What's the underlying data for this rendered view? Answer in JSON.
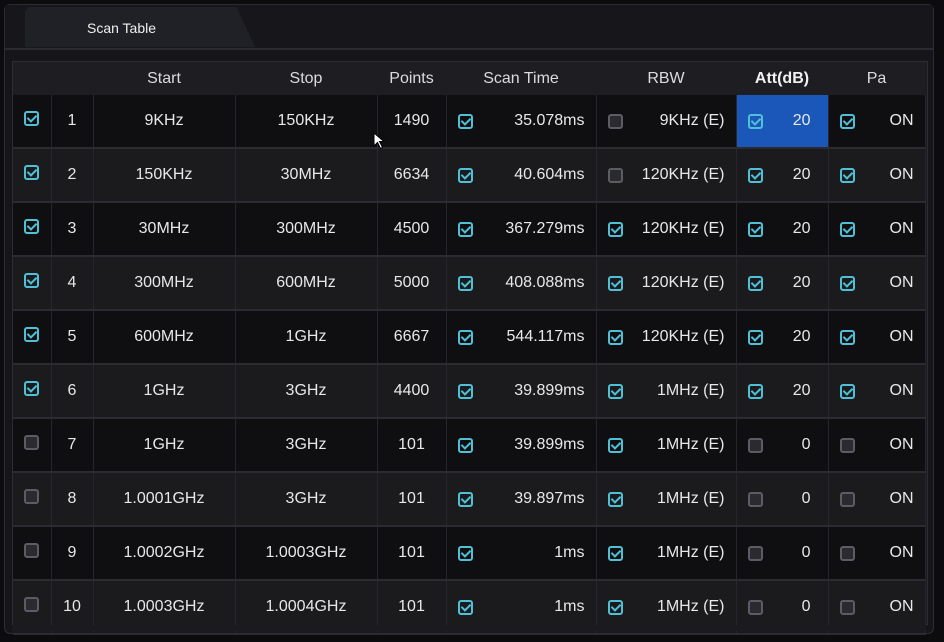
{
  "tab": {
    "label": "Scan Table"
  },
  "colors": {
    "accent": "#4fc0d6",
    "selected": "#1a57b8"
  },
  "columns": {
    "start": "Start",
    "stop": "Stop",
    "points": "Points",
    "scan_time": "Scan Time",
    "rbw": "RBW",
    "att": "Att(dB)",
    "pa": "Pa"
  },
  "rows": [
    {
      "enabled": true,
      "index": "1",
      "start": "9KHz",
      "stop": "150KHz",
      "points": "1490",
      "scan_auto": true,
      "scan_time": "35.078ms",
      "rbw_auto": false,
      "rbw": "9KHz (E)",
      "att_auto": true,
      "att": "20",
      "pa_auto": true,
      "pa": "ON"
    },
    {
      "enabled": true,
      "index": "2",
      "start": "150KHz",
      "stop": "30MHz",
      "points": "6634",
      "scan_auto": true,
      "scan_time": "40.604ms",
      "rbw_auto": false,
      "rbw": "120KHz (E)",
      "att_auto": true,
      "att": "20",
      "pa_auto": true,
      "pa": "ON"
    },
    {
      "enabled": true,
      "index": "3",
      "start": "30MHz",
      "stop": "300MHz",
      "points": "4500",
      "scan_auto": true,
      "scan_time": "367.279ms",
      "rbw_auto": true,
      "rbw": "120KHz (E)",
      "att_auto": true,
      "att": "20",
      "pa_auto": true,
      "pa": "ON"
    },
    {
      "enabled": true,
      "index": "4",
      "start": "300MHz",
      "stop": "600MHz",
      "points": "5000",
      "scan_auto": true,
      "scan_time": "408.088ms",
      "rbw_auto": true,
      "rbw": "120KHz (E)",
      "att_auto": true,
      "att": "20",
      "pa_auto": true,
      "pa": "ON"
    },
    {
      "enabled": true,
      "index": "5",
      "start": "600MHz",
      "stop": "1GHz",
      "points": "6667",
      "scan_auto": true,
      "scan_time": "544.117ms",
      "rbw_auto": true,
      "rbw": "120KHz (E)",
      "att_auto": true,
      "att": "20",
      "pa_auto": true,
      "pa": "ON"
    },
    {
      "enabled": true,
      "index": "6",
      "start": "1GHz",
      "stop": "3GHz",
      "points": "4400",
      "scan_auto": true,
      "scan_time": "39.899ms",
      "rbw_auto": true,
      "rbw": "1MHz (E)",
      "att_auto": true,
      "att": "20",
      "pa_auto": true,
      "pa": "ON"
    },
    {
      "enabled": false,
      "index": "7",
      "start": "1GHz",
      "stop": "3GHz",
      "points": "101",
      "scan_auto": true,
      "scan_time": "39.899ms",
      "rbw_auto": true,
      "rbw": "1MHz (E)",
      "att_auto": false,
      "att": "0",
      "pa_auto": false,
      "pa": "ON"
    },
    {
      "enabled": false,
      "index": "8",
      "start": "1.0001GHz",
      "stop": "3GHz",
      "points": "101",
      "scan_auto": true,
      "scan_time": "39.897ms",
      "rbw_auto": true,
      "rbw": "1MHz (E)",
      "att_auto": false,
      "att": "0",
      "pa_auto": false,
      "pa": "ON"
    },
    {
      "enabled": false,
      "index": "9",
      "start": "1.0002GHz",
      "stop": "1.0003GHz",
      "points": "101",
      "scan_auto": true,
      "scan_time": "1ms",
      "rbw_auto": true,
      "rbw": "1MHz (E)",
      "att_auto": false,
      "att": "0",
      "pa_auto": false,
      "pa": "ON"
    },
    {
      "enabled": false,
      "index": "10",
      "start": "1.0003GHz",
      "stop": "1.0004GHz",
      "points": "101",
      "scan_auto": true,
      "scan_time": "1ms",
      "rbw_auto": true,
      "rbw": "1MHz (E)",
      "att_auto": false,
      "att": "0",
      "pa_auto": false,
      "pa": "ON"
    }
  ]
}
